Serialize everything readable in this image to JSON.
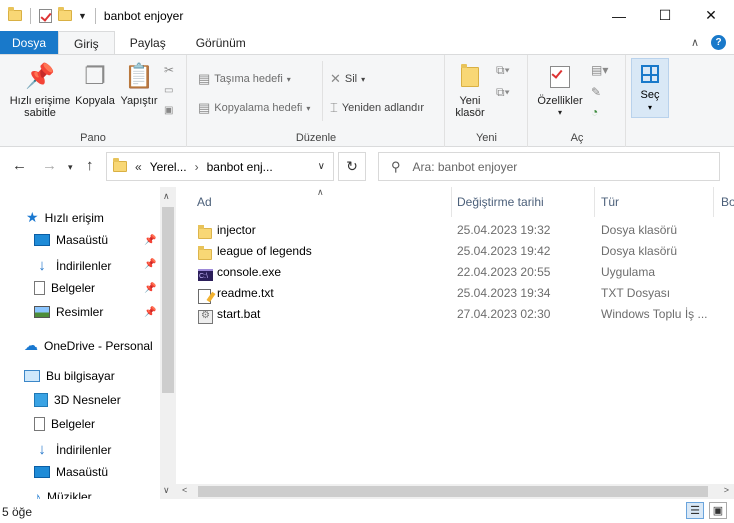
{
  "window": {
    "title": "banbot enjoyer"
  },
  "title_buttons": {
    "minimize": "—",
    "maximize": "☐",
    "close": "✕"
  },
  "tabs": {
    "file": "Dosya",
    "home": "Giriş",
    "share": "Paylaş",
    "view": "Görünüm"
  },
  "ribbon": {
    "pin_label": "Hızlı erişime sabitle",
    "copy_label": "Kopyala",
    "paste_label": "Yapıştır",
    "group_clipboard": "Pano",
    "move_to": "Taşıma hedefi",
    "copy_to": "Kopyalama hedefi",
    "delete": "Sil",
    "rename": "Yeniden adlandır",
    "group_organize": "Düzenle",
    "new_folder": "Yeni klasör",
    "group_new": "Yeni",
    "properties": "Özellikler",
    "group_open": "Aç",
    "select": "Seç"
  },
  "address": {
    "crumb_prefix": "«",
    "crumb1": "Yerel...",
    "crumb2": "banbot enj...",
    "search_placeholder": "Ara: banbot enjoyer"
  },
  "nav": {
    "quick_access": "Hızlı erişim",
    "desktop": "Masaüstü",
    "downloads": "İndirilenler",
    "documents": "Belgeler",
    "pictures": "Resimler",
    "onedrive": "OneDrive - Personal",
    "this_pc": "Bu bilgisayar",
    "objects_3d": "3D Nesneler",
    "pc_documents": "Belgeler",
    "pc_downloads": "İndirilenler",
    "pc_desktop": "Masaüstü",
    "music": "Müzikler"
  },
  "columns": {
    "name": "Ad",
    "date": "Değiştirme tarihi",
    "type": "Tür",
    "size": "Bo"
  },
  "files": [
    {
      "name": "injector",
      "date": "25.04.2023 19:32",
      "type": "Dosya klasörü",
      "icon": "folder-icon"
    },
    {
      "name": "league of legends",
      "date": "25.04.2023 19:42",
      "type": "Dosya klasörü",
      "icon": "folder-icon"
    },
    {
      "name": "console.exe",
      "date": "22.04.2023 20:55",
      "type": "Uygulama",
      "icon": "console-app-icon"
    },
    {
      "name": "readme.txt",
      "date": "25.04.2023 19:34",
      "type": "TXT Dosyası",
      "icon": "text-file-icon"
    },
    {
      "name": "start.bat",
      "date": "27.04.2023 02:30",
      "type": "Windows Toplu İş ...",
      "icon": "batch-file-icon"
    }
  ],
  "status": {
    "item_count": "5 öğe"
  },
  "colors": {
    "accent": "#1979ca",
    "ribbon_bg": "#f5f6f7",
    "select_highlight": "#d9e8f6"
  }
}
